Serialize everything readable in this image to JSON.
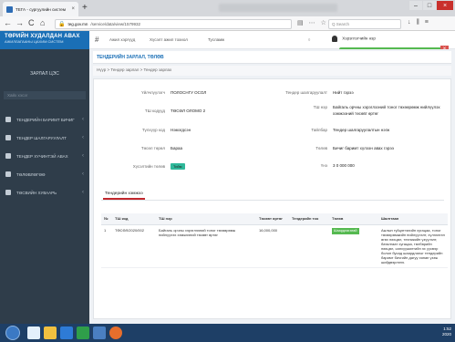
{
  "browser": {
    "tab_title": "ТЕГА - сургуулийн систем",
    "tab_close": "×",
    "new_tab": "+",
    "url_host": "teg.gov.mn",
    "url_rest": "/service/data/view/1579932",
    "search_placeholder": "Q Search",
    "nav_back": "←",
    "nav_forward": "→",
    "nav_reload": "C",
    "nav_home": "⌂",
    "win_min": "–",
    "win_max": "□",
    "win_close": "×"
  },
  "app": {
    "brand_line1": "ТӨРИЙН ХУДАЛДАН АВАХ",
    "brand_line2": "АЖИЛЛАГААНЫ ЦАХИМ СИСТЕМ",
    "section_title": "ЗАРЛАЛ ЦЭС",
    "side_search": "Хайх хэсэг",
    "side_items": [
      {
        "label": "ТЕНДЕРИЙН БАРИМТ БИЧИГ"
      },
      {
        "label": "ТЕНДЕР ШАЛГАРУУЛАЛТ"
      },
      {
        "label": "ТЕНДЕР ХҮЧИНТЭЙ АВАХ"
      },
      {
        "label": "ТӨЛӨВЛӨГӨӨ"
      },
      {
        "label": "ТӨСВИЙН ХУВААРЬ"
      }
    ],
    "top_links": [
      "Ажил хэргүүд",
      "Хүсэлт ажил тохиол",
      "Тусламж"
    ],
    "user_label": "Хэрэглэгчийн нэр",
    "toast_title": "Амжилттай",
    "toast_sub": "мэдээлэл хадгалагдлаа",
    "toast_close": "×"
  },
  "page": {
    "title": "ТЕНДЕРИЙН ЗАРЛАЛ, ТӨЛӨВ",
    "breadcrumb": "Нүүр  >  Тендер зарлал  >  Тендер зарлах",
    "left_fields": [
      {
        "k": "Үйлчлүүлэгч",
        "v": "ПОЛОСНГУ ОСОЛ"
      },
      {
        "k": "ТШ кодууд",
        "v": "ТӨСӨЛ ОЛОМО 2"
      },
      {
        "k": "Түлхүүр код",
        "v": "Нэмэгдсэн"
      },
      {
        "k": "Төсөл төрөл",
        "v": "Бараа"
      },
      {
        "k": "Хүсэлтийн төлөв",
        "v": "Тийм"
      }
    ],
    "right_fields": [
      {
        "k": "Тендер шалгаруулалт",
        "v": "Нийт гэрээ"
      },
      {
        "k": "ТШ нэр",
        "v": "Байгаль орчны хэрэглээний тоног төхөөрөмж нийлүүлэх"
      },
      {
        "k": "ТШ нэр 2",
        "v": "хэмжээний төсөвт өртөг"
      },
      {
        "k": "Тайлбар",
        "v": "Тендер шалгаруулалтын нэгж"
      },
      {
        "k": "Төлөв",
        "v": "Бичиг баримт хүлээн авах гэрээ"
      },
      {
        "k": "Үнэ",
        "v": "3 0 000 000"
      }
    ],
    "tab_label": "Тендерийн хэмжээ",
    "table": {
      "headers": [
        "№",
        "ТШ код",
        "ТШ нэр",
        "Төсөвт өртөг",
        "Тендерийн тоо",
        "Төлөв",
        "Шалтгаан"
      ],
      "rows": [
        {
          "n": "1",
          "code": "ТӨСӨЛ/2020/002",
          "name": "Байгаль орчны хэрэглээний тоног төхөөрөмж нийлүүлэх хэмжээний төсөвт өртөг",
          "budget": "16,000,000",
          "count": "",
          "status": "Шаардлагатай",
          "reason": "Ажлын гүйцэтгэлийн хугацаа, тоног төхөөрөмжийн нийлүүлэлт, хүлээлгэн өгөх нөхцөл, техникийн үзүүлэлт, баталгаат хугацаа, төлбөрийн нөхцөл, санхүүжилтийн эх үүсвэр болон бусад шаардлагыг тендерийн баримт бичгийн дагуу хянан үзэж шийдвэрлэнэ."
        }
      ]
    }
  },
  "taskbar": {
    "time": "1:52",
    "date": "2020"
  }
}
